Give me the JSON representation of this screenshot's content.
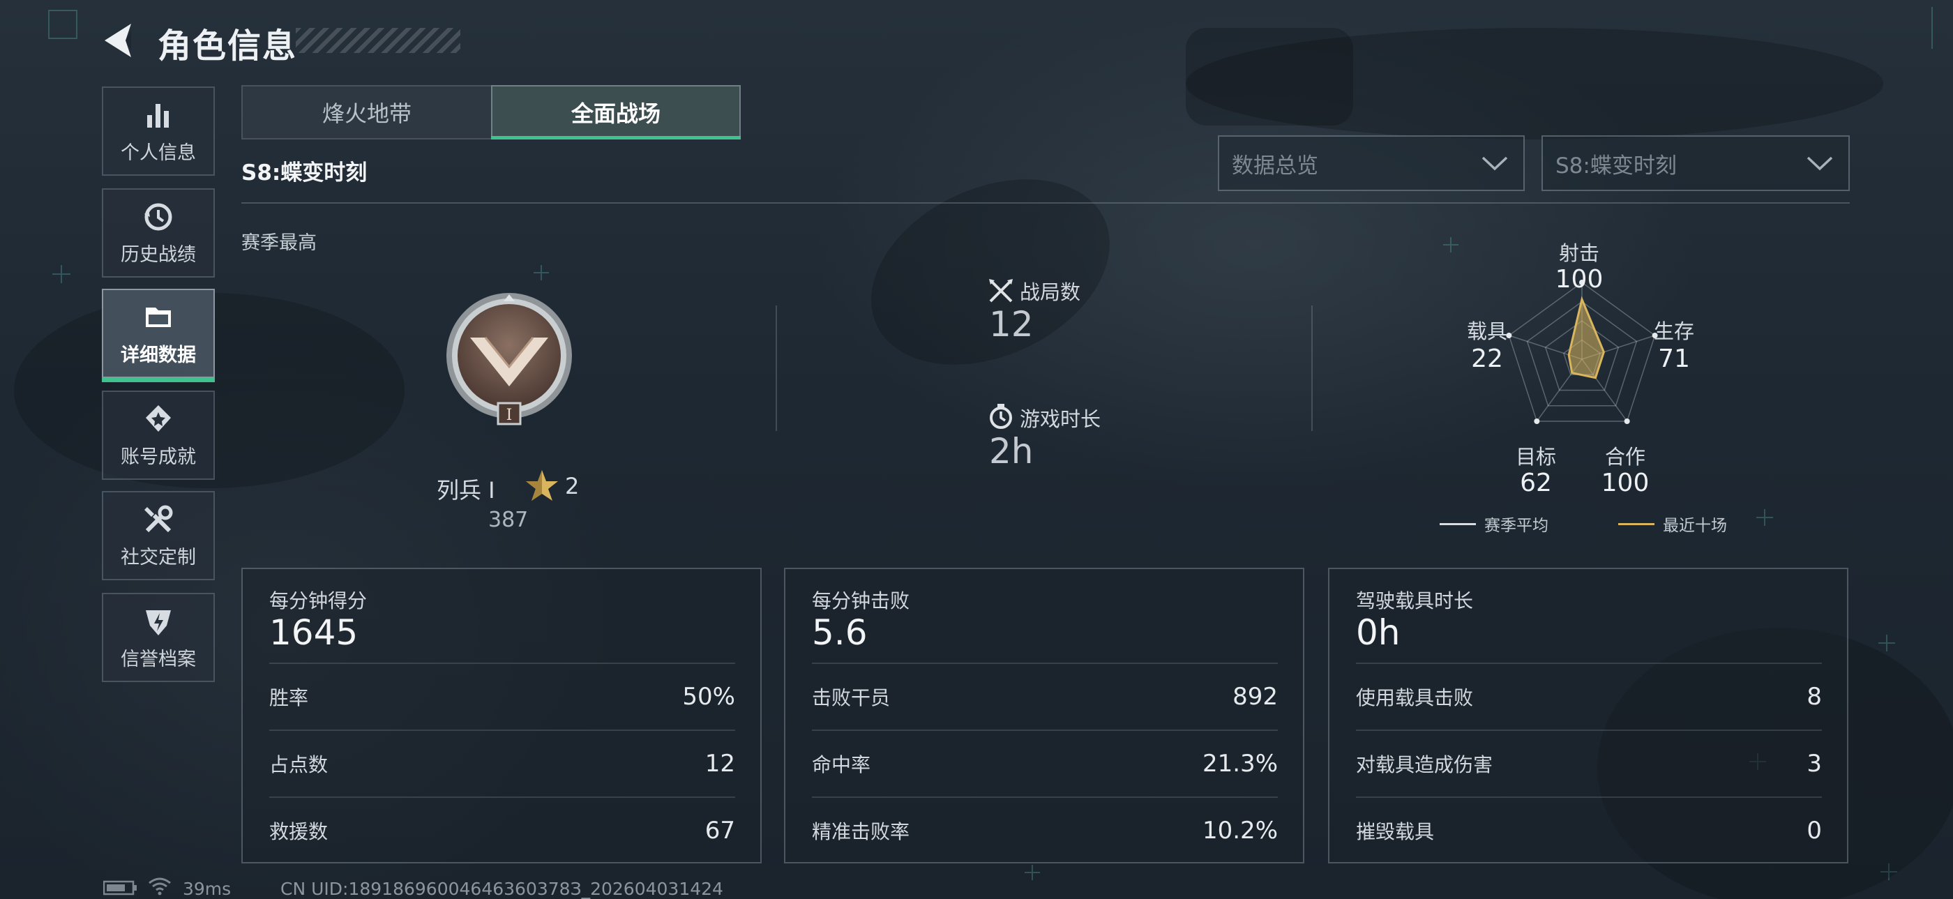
{
  "header": {
    "title": "角色信息"
  },
  "sidebar": {
    "items": [
      {
        "label": "个人信息",
        "icon": "bar-chart-icon"
      },
      {
        "label": "历史战绩",
        "icon": "history-clock-icon"
      },
      {
        "label": "详细数据",
        "icon": "folder-icon",
        "active": true
      },
      {
        "label": "账号成就",
        "icon": "medal-icon"
      },
      {
        "label": "社交定制",
        "icon": "tools-icon"
      },
      {
        "label": "信誉档案",
        "icon": "credit-shield-icon"
      }
    ]
  },
  "tabs": [
    {
      "label": "烽火地带",
      "active": false
    },
    {
      "label": "全面战场",
      "active": true
    }
  ],
  "season": {
    "title": "S8:蝶变时刻",
    "best_label": "赛季最高"
  },
  "filters": {
    "scope": {
      "value": "数据总览"
    },
    "season": {
      "value": "S8:蝶变时刻"
    }
  },
  "rank": {
    "name": "列兵 Ⅰ",
    "stars": "2",
    "points": "387",
    "emblem_numeral": "I"
  },
  "summary": {
    "matches": {
      "label": "战局数",
      "value": "12",
      "icon": "crossed-swords-icon"
    },
    "playtime": {
      "label": "游戏时长",
      "value": "2h",
      "icon": "stopwatch-icon"
    }
  },
  "radar": {
    "axes": [
      {
        "label": "射击",
        "value": "100"
      },
      {
        "label": "生存",
        "value": "71"
      },
      {
        "label": "合作",
        "value": "100"
      },
      {
        "label": "目标",
        "value": "62"
      },
      {
        "label": "载具",
        "value": "22"
      }
    ],
    "recent_shape": [
      0.78,
      0.3,
      0.3,
      0.22,
      0.18
    ],
    "legend": {
      "season_avg": {
        "label": "赛季平均",
        "color": "#d8dde2"
      },
      "recent_ten": {
        "label": "最近十场",
        "color": "#d9b65e"
      }
    }
  },
  "panels": [
    {
      "label": "每分钟得分",
      "value": "1645",
      "rows": [
        {
          "k": "胜率",
          "v": "50%"
        },
        {
          "k": "占点数",
          "v": "12"
        },
        {
          "k": "救援数",
          "v": "67"
        }
      ]
    },
    {
      "label": "每分钟击败",
      "value": "5.6",
      "rows": [
        {
          "k": "击败干员",
          "v": "892"
        },
        {
          "k": "命中率",
          "v": "21.3%"
        },
        {
          "k": "精准击败率",
          "v": "10.2%"
        }
      ]
    },
    {
      "label": "驾驶载具时长",
      "value": "0h",
      "rows": [
        {
          "k": "使用载具击败",
          "v": "8"
        },
        {
          "k": "对载具造成伤害",
          "v": "3"
        },
        {
          "k": "摧毁载具",
          "v": "0"
        }
      ]
    }
  ],
  "footer": {
    "ping": "39ms",
    "uid": "CN UID:18918696004646360378З_202604031424"
  },
  "colors": {
    "accent": "#3ec38f",
    "gold": "#d9b65e"
  }
}
